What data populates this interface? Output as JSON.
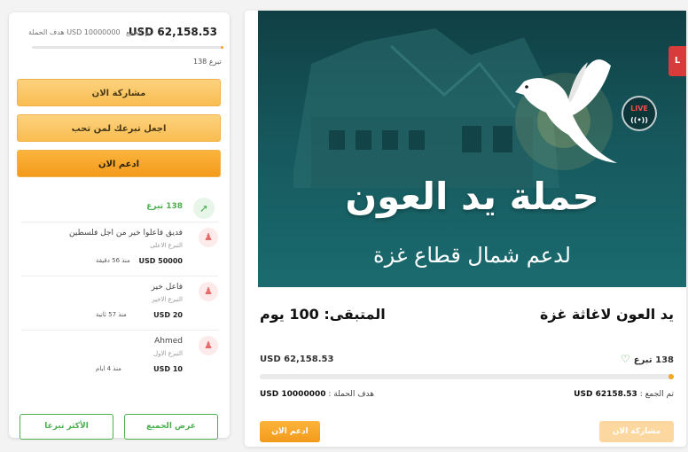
{
  "sidebar": {
    "raised": "USD 62,158.53",
    "raised_label": "تم الجمع",
    "goal_text": "USD 10000000 هدف الحملة",
    "donors_count": "138 تبرع",
    "progress_fraction": 0.006,
    "buttons": {
      "share_now": "مشاركة الان",
      "donate_for_loved": "اجعل تبرعك لمن تحب",
      "support_now": "ادعم الان"
    },
    "donations_label": "138 تبرع",
    "donations": [
      {
        "name": "فديق فاعلوا خير من اجل فلسطين",
        "kind": "التبرع الاعلى",
        "amount": "USD 50000",
        "ago": "منذ 56 دقيقة"
      },
      {
        "name": "فاعل خير",
        "kind": "التبرع الاخير",
        "amount": "USD 20",
        "ago": "منذ 57 ثانية"
      },
      {
        "name": "Ahmed",
        "kind": "التبرع الاول",
        "amount": "USD 10",
        "ago": "منذ 4 ايام"
      }
    ],
    "bottom_buttons": {
      "top_donors": "الأكثر تبرعا",
      "show_all": "عرض الجميع"
    }
  },
  "campaign": {
    "hero_title": "حملة يد العون",
    "hero_subtitle": "لدعم شمال قطاع غزة",
    "live_badge": "LIVE",
    "title": "يد العون لاغاثة غزة",
    "remaining": "المتبقى: 100 يوم",
    "raised": "USD 62,158.53",
    "donors_count": "138 تبرع",
    "progress_fraction": 0.006,
    "raised_line_label": "تم الجمع :",
    "raised_line_value": "USD 62158.53",
    "goal_label": "هدف الحملة :",
    "goal_value": "USD 10000000",
    "buttons": {
      "donate": "ادعم الان",
      "share": "مشاركة الان"
    }
  },
  "colors": {
    "accent_orange": "#f5a623",
    "accent_green": "#4caf50",
    "hero_teal": "#16575c"
  },
  "icons": {
    "trend": "trending-up-icon",
    "avatar": "user-icon",
    "heart": "heart-icon"
  }
}
